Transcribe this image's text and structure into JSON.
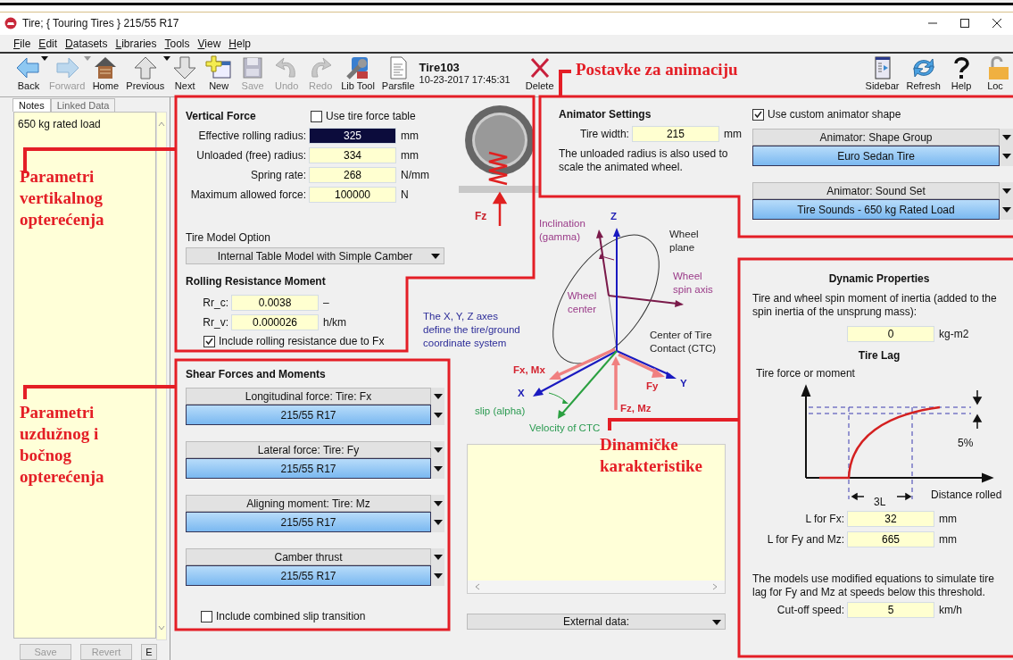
{
  "window": {
    "title": "Tire;  { Touring Tires }  215/55 R17"
  },
  "menu": [
    "File",
    "Edit",
    "Datasets",
    "Libraries",
    "Tools",
    "View",
    "Help"
  ],
  "toolbar": {
    "left": [
      {
        "label": "Back",
        "kind": "back",
        "disabled": false,
        "has_menu": true
      },
      {
        "label": "Forward",
        "kind": "forward",
        "disabled": true,
        "has_menu": true
      },
      {
        "label": "Home",
        "kind": "home",
        "disabled": false,
        "has_menu": false
      },
      {
        "label": "Previous",
        "kind": "previous",
        "disabled": false,
        "has_menu": true
      },
      {
        "label": "Next",
        "kind": "next",
        "disabled": false,
        "has_menu": false
      },
      {
        "label": "New",
        "kind": "new",
        "disabled": false,
        "has_menu": false
      },
      {
        "label": "Save",
        "kind": "save",
        "disabled": true,
        "has_menu": false
      },
      {
        "label": "Undo",
        "kind": "undo",
        "disabled": true,
        "has_menu": false
      },
      {
        "label": "Redo",
        "kind": "redo",
        "disabled": true,
        "has_menu": false
      },
      {
        "label": "Lib Tool",
        "kind": "libtool",
        "disabled": false,
        "has_menu": false
      },
      {
        "label": "Parsfile",
        "kind": "parsfile",
        "disabled": false,
        "has_menu": false
      }
    ],
    "dataset": {
      "name": "Tire103",
      "timestamp": "10-23-2017 17:45:31"
    },
    "actions": [
      {
        "label": "Delete",
        "kind": "delete",
        "disabled": false,
        "has_menu": false
      }
    ],
    "right": [
      {
        "label": "Sidebar",
        "kind": "sidebar",
        "disabled": false,
        "has_menu": false
      },
      {
        "label": "Refresh",
        "kind": "refresh",
        "disabled": false,
        "has_menu": false
      },
      {
        "label": "Help",
        "kind": "help",
        "disabled": false,
        "has_menu": false
      },
      {
        "label": "Loc",
        "kind": "lock",
        "disabled": false,
        "has_menu": false
      }
    ]
  },
  "sidebar": {
    "tabs": [
      {
        "label": "Notes",
        "selected": true
      },
      {
        "label": "Linked Data",
        "selected": false
      }
    ],
    "notes": "650 kg rated load",
    "buttons": [
      {
        "label": "Save",
        "disabled": true
      },
      {
        "label": "Revert",
        "disabled": true
      },
      {
        "label": "E",
        "disabled": false
      }
    ]
  },
  "vertical_force": {
    "title": "Vertical Force",
    "use_table": {
      "label": "Use tire force table",
      "checked": false
    },
    "fields": [
      {
        "label": "Effective rolling radius:",
        "value": "325",
        "unit": "mm",
        "focused": true
      },
      {
        "label": "Unloaded (free) radius:",
        "value": "334",
        "unit": "mm",
        "focused": false
      },
      {
        "label": "Spring rate:",
        "value": "268",
        "unit": "N/mm",
        "focused": false
      },
      {
        "label": "Maximum allowed force:",
        "value": "100000",
        "unit": "N",
        "focused": false
      }
    ],
    "drawing_label": "Fz",
    "model_option": {
      "label": "Tire Model Option",
      "value": "Internal Table Model with Simple Camber"
    },
    "rolling": {
      "title": "Rolling Resistance Moment",
      "fields": [
        {
          "label": "Rr_c:",
          "value": "0.0038",
          "unit": "–"
        },
        {
          "label": "Rr_v:",
          "value": "0.000026",
          "unit": "h/km"
        }
      ],
      "include": {
        "label": "Include rolling resistance due to Fx",
        "checked": true
      }
    }
  },
  "diagram": {
    "labels": [
      {
        "text": "Inclination (gamma)",
        "kind": "wheel"
      },
      {
        "text": "Z",
        "kind": "axis"
      },
      {
        "text": "Wheel plane",
        "kind": "geometry"
      },
      {
        "text": "Wheel spin axis",
        "kind": "wheel"
      },
      {
        "text": "Wheel center",
        "kind": "wheel"
      },
      {
        "text": "Center of Tire Contact (CTC)",
        "kind": "geometry"
      },
      {
        "text": "The X, Y, Z axes define the tire/ground coordinate system",
        "kind": "note"
      },
      {
        "text": "Fx, Mx",
        "kind": "force"
      },
      {
        "text": "X",
        "kind": "axis"
      },
      {
        "text": "Fy",
        "kind": "force"
      },
      {
        "text": "Y",
        "kind": "axis"
      },
      {
        "text": "Fz, Mz",
        "kind": "force"
      },
      {
        "text": "slip (alpha)",
        "kind": "motion"
      },
      {
        "text": "Velocity of CTC",
        "kind": "motion"
      }
    ]
  },
  "shear": {
    "title": "Shear Forces and Moments",
    "dropdowns": [
      {
        "label": "Longitudinal force: Tire: Fx",
        "value": "215/55 R17"
      },
      {
        "label": "Lateral force: Tire: Fy",
        "value": "215/55 R17"
      },
      {
        "label": "Aligning moment: Tire: Mz",
        "value": "215/55 R17"
      },
      {
        "label": "Camber thrust",
        "value": "215/55 R17"
      }
    ],
    "combined": {
      "label": "Include combined slip transition",
      "checked": false
    }
  },
  "external_data": {
    "label": "External data:"
  },
  "animator": {
    "title": "Animator Settings",
    "width": {
      "label": "Tire width:",
      "value": "215",
      "unit": "mm"
    },
    "note": "The unloaded radius is also used to scale the animated wheel.",
    "custom": {
      "label": "Use custom animator shape",
      "checked": true
    },
    "dropdowns": [
      {
        "label": "Animator: Shape Group",
        "value": "Euro Sedan Tire"
      },
      {
        "label": "Animator: Sound Set",
        "value": "Tire Sounds - 650 kg Rated Load"
      }
    ]
  },
  "dynamic": {
    "title": "Dynamic Properties",
    "inertia_note": "Tire and wheel spin moment of inertia (added to the spin inertia of the unsprung mass):",
    "inertia": {
      "value": "0",
      "unit": "kg-m2"
    },
    "lag_title": "Tire Lag",
    "lag_labels": [
      "Tire force or moment",
      "5%",
      "3L",
      "Distance rolled"
    ],
    "lag_fields": [
      {
        "label": "L for Fx:",
        "value": "32",
        "unit": "mm"
      },
      {
        "label": "L for Fy and Mz:",
        "value": "665",
        "unit": "mm"
      }
    ],
    "note": "The models use modified equations to simulate tire lag for Fy and Mz at  speeds below this threshold.",
    "cutoff": {
      "label": "Cut-off speed:",
      "value": "5",
      "unit": "km/h"
    }
  },
  "annotations": [
    {
      "text": "Parametri vertikalnog opterećenja"
    },
    {
      "text": "Postavke za animaciju"
    },
    {
      "text": "Parametri uzdužnog i bočnog opterećenja"
    },
    {
      "text": "Dinamičke karakteristike"
    }
  ]
}
